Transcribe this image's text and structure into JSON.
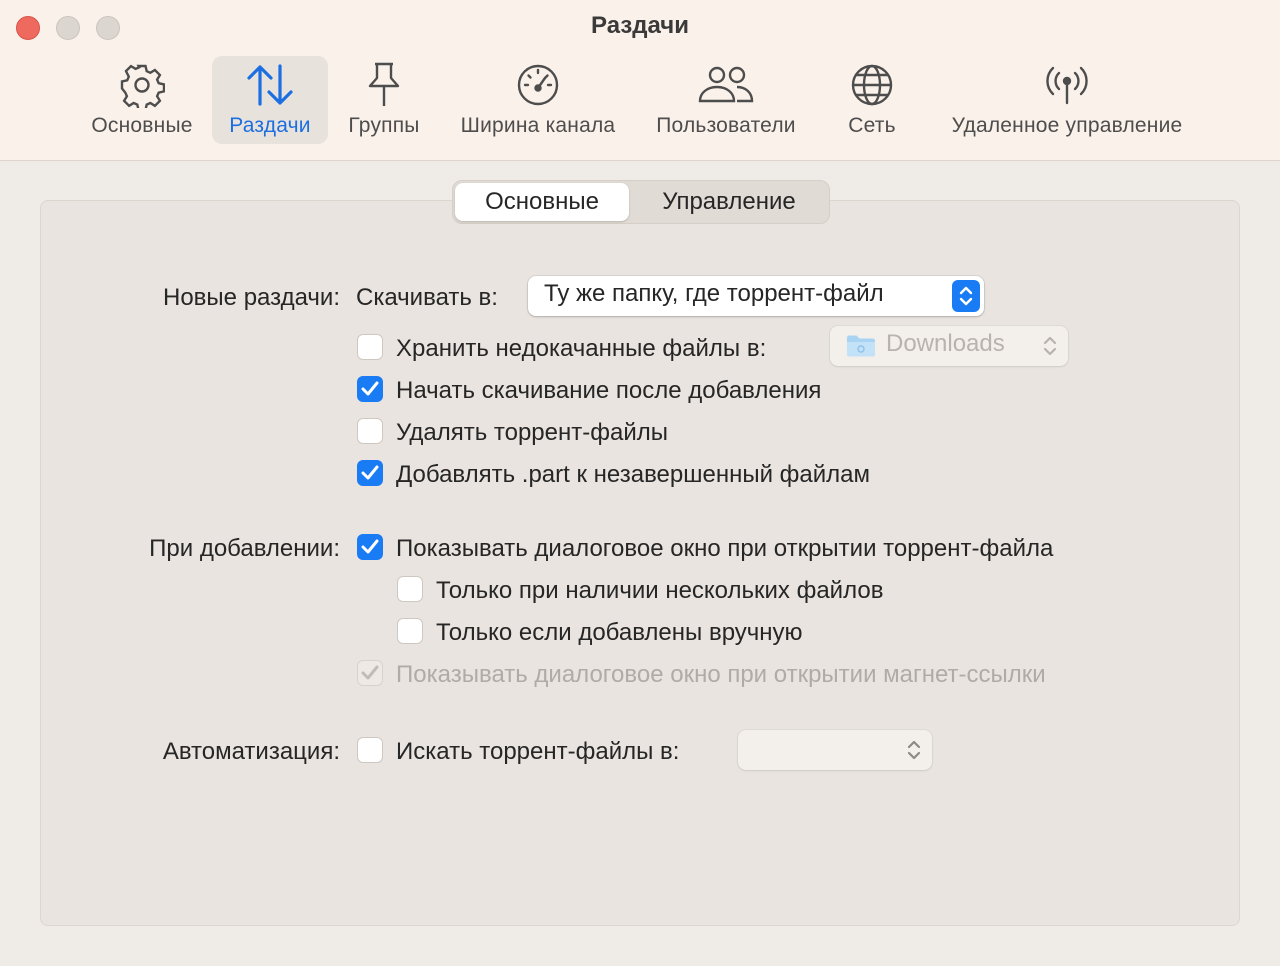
{
  "window": {
    "title": "Раздачи"
  },
  "toolbar": {
    "items": [
      {
        "label": "Основные",
        "icon": "gear-icon"
      },
      {
        "label": "Раздачи",
        "icon": "transfers-arrows-icon",
        "active": true
      },
      {
        "label": "Группы",
        "icon": "pin-icon"
      },
      {
        "label": "Ширина канала",
        "icon": "speedometer-icon"
      },
      {
        "label": "Пользователи",
        "icon": "users-icon"
      },
      {
        "label": "Сеть",
        "icon": "globe-icon"
      },
      {
        "label": "Удаленное управление",
        "icon": "antenna-icon"
      }
    ]
  },
  "tabs": {
    "items": [
      "Основные",
      "Управление"
    ],
    "selected": "Основные"
  },
  "new_transfers": {
    "label": "Новые раздачи:",
    "download_to_label": "Скачивать в:",
    "download_to_value": "Ту же папку, где торрент-файл",
    "keep_incomplete": {
      "label": "Хранить недокачанные файлы в:",
      "checked": false,
      "folder": "Downloads"
    },
    "start_after_add": {
      "label": "Начать скачивание после добавления",
      "checked": true
    },
    "delete_torrents": {
      "label": "Удалять торрент-файлы",
      "checked": false
    },
    "add_part": {
      "label": "Добавлять .part к незавершенный файлам",
      "checked": true
    }
  },
  "on_add": {
    "label": "При добавлении:",
    "show_dialog": {
      "label": "Показывать диалоговое окно при открытии торрент-файла",
      "checked": true
    },
    "only_multiple": {
      "label": "Только при наличии нескольких файлов",
      "checked": false
    },
    "only_manual": {
      "label": "Только если добавлены вручную",
      "checked": false
    },
    "show_magnet": {
      "label": "Показывать диалоговое окно при открытии магнет-ссылки",
      "checked": true,
      "disabled": true
    }
  },
  "automation": {
    "label": "Автоматизация:",
    "watch_folder": {
      "label": "Искать торрент-файлы в:",
      "checked": false,
      "folder": ""
    }
  },
  "colors": {
    "accent": "#1a7cf5",
    "close": "#ee6a5e"
  }
}
